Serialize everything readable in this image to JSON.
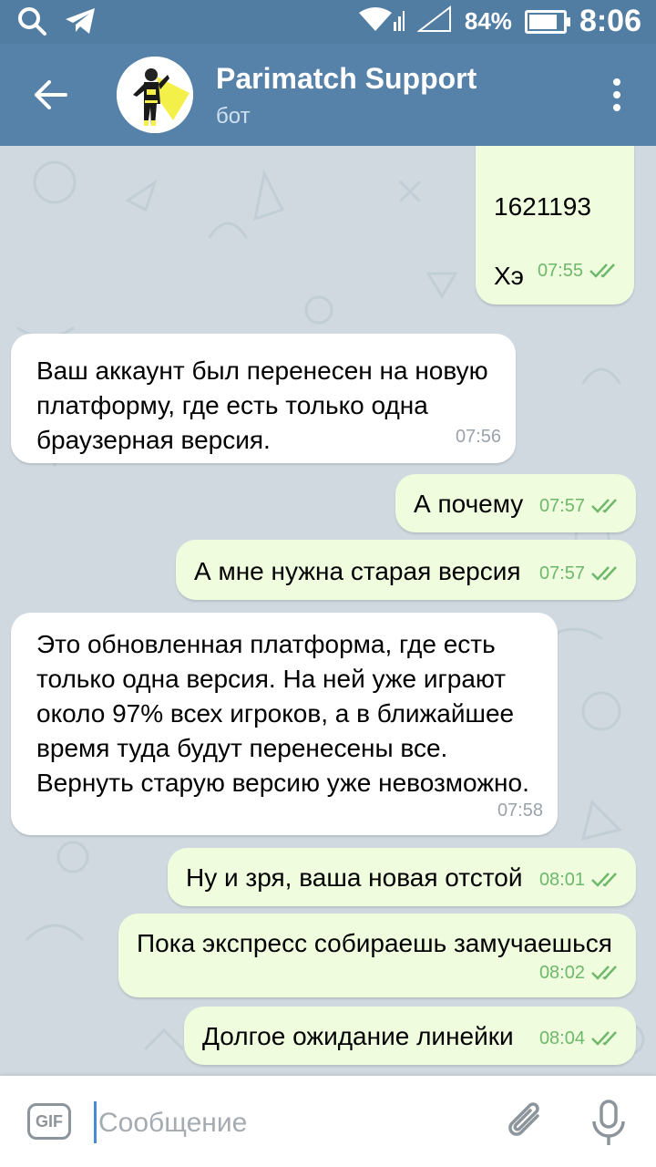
{
  "status_bar": {
    "battery_percent": "84%",
    "time": "8:06",
    "battery_level": 0.84
  },
  "header": {
    "title": "Parimatch Support",
    "subtitle": "бот"
  },
  "messages": [
    {
      "direction": "out",
      "lines": [
        "1621193",
        "",
        "Хэ"
      ],
      "time": "07:55",
      "read": true
    },
    {
      "direction": "in",
      "text": "Ваш аккаунт был перенесен на новую платформу, где есть только одна браузерная версия.",
      "time": "07:56"
    },
    {
      "direction": "out",
      "text": "А почему",
      "time": "07:57",
      "read": true
    },
    {
      "direction": "out",
      "text": "А мне нужна старая версия",
      "time": "07:57",
      "read": true
    },
    {
      "direction": "in",
      "text": "Это обновленная платформа, где есть только одна версия. На ней уже играют около 97% всех игроков, а в ближайшее время туда будут перенесены все. Вернуть старую версию уже невозможно.",
      "time": "07:58"
    },
    {
      "direction": "out",
      "text": "Ну и зря, ваша новая отстой",
      "time": "08:01",
      "read": true
    },
    {
      "direction": "out",
      "text": "Пока экспресс собираешь замучаешься",
      "time": "08:02",
      "read": true
    },
    {
      "direction": "out",
      "text": "Долгое ожидание линейки",
      "time": "08:04",
      "read": true
    }
  ],
  "input": {
    "gif_label": "GIF",
    "placeholder": "Сообщение"
  },
  "colors": {
    "header": "#5682a9",
    "status_bar": "#527da3",
    "bubble_out": "#effdde",
    "bubble_in": "#ffffff",
    "check": "#6db86b"
  }
}
